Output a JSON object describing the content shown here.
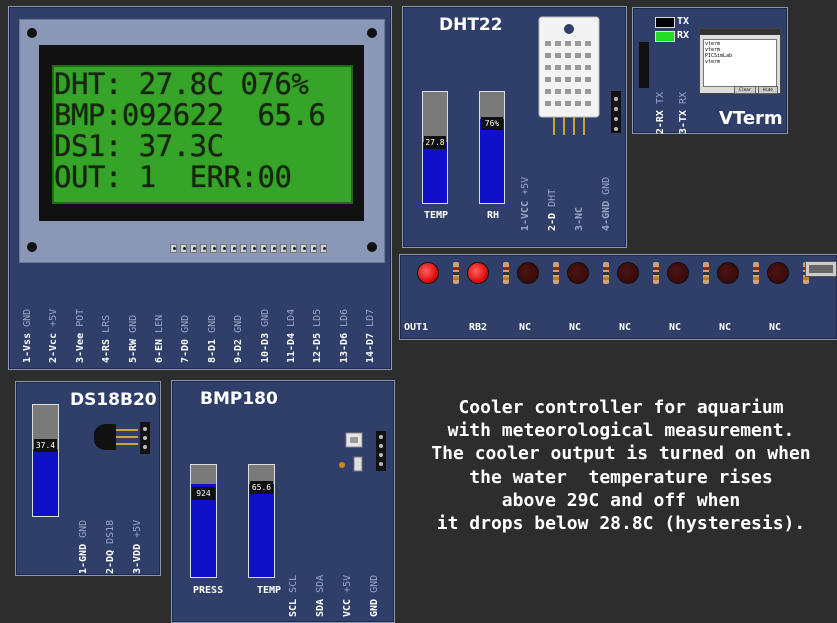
{
  "lcd": {
    "lines": [
      "DHT: 27.8C 076%",
      "BMP:092622  65.6",
      "DS1: 37.3C",
      "OUT: 1  ERR:00"
    ],
    "pins": [
      {
        "name": "1-Vss",
        "alt": "GND"
      },
      {
        "name": "2-Vcc",
        "alt": "+5V"
      },
      {
        "name": "3-Vee",
        "alt": "POT"
      },
      {
        "name": "4-RS",
        "alt": "LRS"
      },
      {
        "name": "5-RW",
        "alt": "GND"
      },
      {
        "name": "6-EN",
        "alt": "LEN"
      },
      {
        "name": "7-D0",
        "alt": "GND"
      },
      {
        "name": "8-D1",
        "alt": "GND"
      },
      {
        "name": "9-D2",
        "alt": "GND"
      },
      {
        "name": "10-D3",
        "alt": "GND"
      },
      {
        "name": "11-D4",
        "alt": "LD4"
      },
      {
        "name": "12-D5",
        "alt": "LD5"
      },
      {
        "name": "13-D6",
        "alt": "LD6"
      },
      {
        "name": "14-D7",
        "alt": "LD7"
      }
    ]
  },
  "dht22": {
    "title": "DHT22",
    "temp": {
      "label": "TEMP",
      "value": "27.8",
      "level": 0.55
    },
    "rh": {
      "label": "RH",
      "value": "76%",
      "level": 0.76
    },
    "pins": [
      {
        "name": "1-VCC",
        "alt": "+5V",
        "active": false
      },
      {
        "name": "2-D",
        "alt": "DHT",
        "active": true
      },
      {
        "name": "3-NC",
        "alt": "",
        "active": false
      },
      {
        "name": "4-GND",
        "alt": "GND",
        "active": false
      }
    ]
  },
  "vterm": {
    "title": "VTerm",
    "tx_label": "TX",
    "rx_label": "RX",
    "tx_color": "#000000",
    "rx_color": "#22dd22",
    "pin_labels": [
      {
        "name": "2-RX",
        "alt": "TX"
      },
      {
        "name": "3-TX",
        "alt": "RX"
      }
    ],
    "screen_lines": [
      "vterm",
      "vterm",
      "PICSimLab",
      "vterm"
    ],
    "buttons": [
      "Clear",
      "Hide"
    ]
  },
  "leds": [
    {
      "label": "OUT1",
      "color": "#e01010",
      "on": true
    },
    {
      "label": "RB2",
      "color": "#e01010",
      "on": true
    },
    {
      "label": "NC",
      "color": "#3a0a0a",
      "on": false
    },
    {
      "label": "NC",
      "color": "#3a0a0a",
      "on": false
    },
    {
      "label": "NC",
      "color": "#3a0a0a",
      "on": false
    },
    {
      "label": "NC",
      "color": "#3a0a0a",
      "on": false
    },
    {
      "label": "NC",
      "color": "#3a0a0a",
      "on": false
    },
    {
      "label": "NC",
      "color": "#3a0a0a",
      "on": false
    }
  ],
  "ds18b20": {
    "title": "DS18B20",
    "temp": {
      "value": "37.4",
      "level": 0.6
    },
    "pins": [
      {
        "name": "1-GND",
        "alt": "GND"
      },
      {
        "name": "2-DQ",
        "alt": "DS18"
      },
      {
        "name": "3-VDD",
        "alt": "+5V"
      }
    ]
  },
  "bmp180": {
    "title": "BMP180",
    "press": {
      "label": "PRESS",
      "value": "924",
      "level": 0.83
    },
    "temp": {
      "label": "TEMP",
      "value": "65.6",
      "level": 0.83
    },
    "pins": [
      {
        "name": "SCL",
        "alt": "SCL"
      },
      {
        "name": "SDA",
        "alt": "SDA"
      },
      {
        "name": "VCC",
        "alt": "+5V"
      },
      {
        "name": "GND",
        "alt": "GND"
      }
    ]
  },
  "note": "Cooler controller for aquarium\nwith meteorological measurement.\nThe cooler output is turned on when\nthe water  temperature rises\nabove 29C and off when\nit drops below 28.8C (hysteresis)."
}
